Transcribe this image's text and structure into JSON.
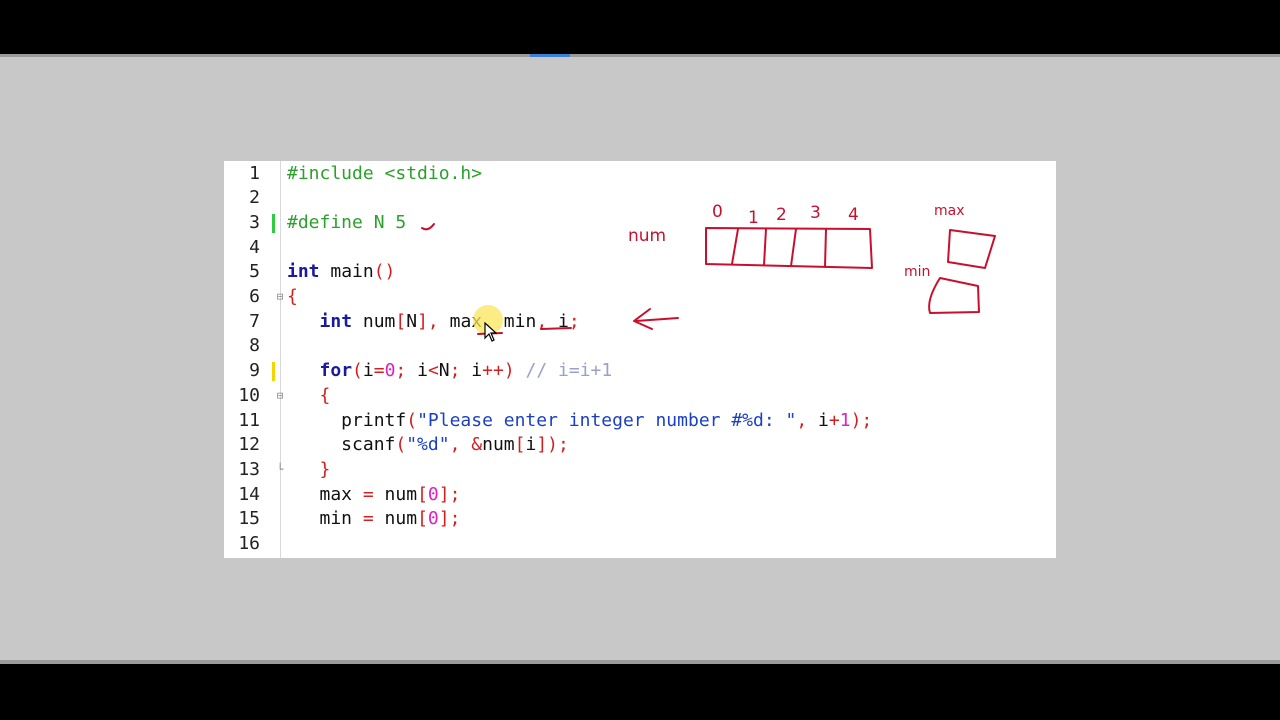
{
  "editor": {
    "lines": [
      {
        "n": "1",
        "tokens": [
          {
            "t": "#include <stdio.h>",
            "c": "pp"
          }
        ]
      },
      {
        "n": "2",
        "tokens": []
      },
      {
        "n": "3",
        "tokens": [
          {
            "t": "#define N 5",
            "c": "pp"
          }
        ]
      },
      {
        "n": "4",
        "tokens": []
      },
      {
        "n": "5",
        "tokens": [
          {
            "t": "int",
            "c": "kw"
          },
          {
            "t": " main",
            "c": "tx"
          },
          {
            "t": "()",
            "c": "pn"
          }
        ]
      },
      {
        "n": "6",
        "tokens": [
          {
            "t": "{",
            "c": "pn"
          }
        ]
      },
      {
        "n": "7",
        "tokens": [
          {
            "t": "   ",
            "c": "tx"
          },
          {
            "t": "int",
            "c": "kw"
          },
          {
            "t": " num",
            "c": "tx"
          },
          {
            "t": "[",
            "c": "pn"
          },
          {
            "t": "N",
            "c": "tx"
          },
          {
            "t": "],",
            "c": "pn"
          },
          {
            "t": " max",
            "c": "tx"
          },
          {
            "t": ",",
            "c": "pn"
          },
          {
            "t": " min",
            "c": "tx"
          },
          {
            "t": ",",
            "c": "pn"
          },
          {
            "t": " i",
            "c": "tx"
          },
          {
            "t": ";",
            "c": "pn"
          }
        ]
      },
      {
        "n": "8",
        "tokens": []
      },
      {
        "n": "9",
        "tokens": [
          {
            "t": "   ",
            "c": "tx"
          },
          {
            "t": "for",
            "c": "kw"
          },
          {
            "t": "(",
            "c": "pn"
          },
          {
            "t": "i",
            "c": "tx"
          },
          {
            "t": "=",
            "c": "pn"
          },
          {
            "t": "0",
            "c": "num"
          },
          {
            "t": ";",
            "c": "pn"
          },
          {
            "t": " i",
            "c": "tx"
          },
          {
            "t": "<",
            "c": "pn"
          },
          {
            "t": "N",
            "c": "tx"
          },
          {
            "t": ";",
            "c": "pn"
          },
          {
            "t": " i",
            "c": "tx"
          },
          {
            "t": "++)",
            "c": "pn"
          },
          {
            "t": " // i=i+1",
            "c": "cm"
          }
        ]
      },
      {
        "n": "10",
        "tokens": [
          {
            "t": "   ",
            "c": "tx"
          },
          {
            "t": "{",
            "c": "pn"
          }
        ]
      },
      {
        "n": "11",
        "tokens": [
          {
            "t": "     printf",
            "c": "tx"
          },
          {
            "t": "(",
            "c": "pn"
          },
          {
            "t": "\"Please enter integer number #%d: \"",
            "c": "str"
          },
          {
            "t": ",",
            "c": "pn"
          },
          {
            "t": " i",
            "c": "tx"
          },
          {
            "t": "+",
            "c": "pn"
          },
          {
            "t": "1",
            "c": "num"
          },
          {
            "t": ");",
            "c": "pn"
          }
        ]
      },
      {
        "n": "12",
        "tokens": [
          {
            "t": "     scanf",
            "c": "tx"
          },
          {
            "t": "(",
            "c": "pn"
          },
          {
            "t": "\"%d\"",
            "c": "str"
          },
          {
            "t": ",",
            "c": "pn"
          },
          {
            "t": " &",
            "c": "pn"
          },
          {
            "t": "num",
            "c": "tx"
          },
          {
            "t": "[",
            "c": "pn"
          },
          {
            "t": "i",
            "c": "tx"
          },
          {
            "t": "]);",
            "c": "pn"
          }
        ]
      },
      {
        "n": "13",
        "tokens": [
          {
            "t": "   ",
            "c": "tx"
          },
          {
            "t": "}",
            "c": "pn"
          }
        ]
      },
      {
        "n": "14",
        "tokens": [
          {
            "t": "   max ",
            "c": "tx"
          },
          {
            "t": "=",
            "c": "pn"
          },
          {
            "t": " num",
            "c": "tx"
          },
          {
            "t": "[",
            "c": "pn"
          },
          {
            "t": "0",
            "c": "num"
          },
          {
            "t": "];",
            "c": "pn"
          }
        ]
      },
      {
        "n": "15",
        "tokens": [
          {
            "t": "   min ",
            "c": "tx"
          },
          {
            "t": "=",
            "c": "pn"
          },
          {
            "t": " num",
            "c": "tx"
          },
          {
            "t": "[",
            "c": "pn"
          },
          {
            "t": "0",
            "c": "num"
          },
          {
            "t": "];",
            "c": "pn"
          }
        ]
      },
      {
        "n": "16",
        "tokens": []
      }
    ]
  },
  "annotations": {
    "array_label": "num",
    "indices": [
      "0",
      "1",
      "2",
      "3",
      "4"
    ],
    "max_label": "max",
    "min_label": "min"
  },
  "colors": {
    "ink": "#c8102e",
    "cursor_highlight": "#fae65a",
    "change_marker_saved": "#2ecc40",
    "change_marker_unsaved": "#f5d400"
  }
}
